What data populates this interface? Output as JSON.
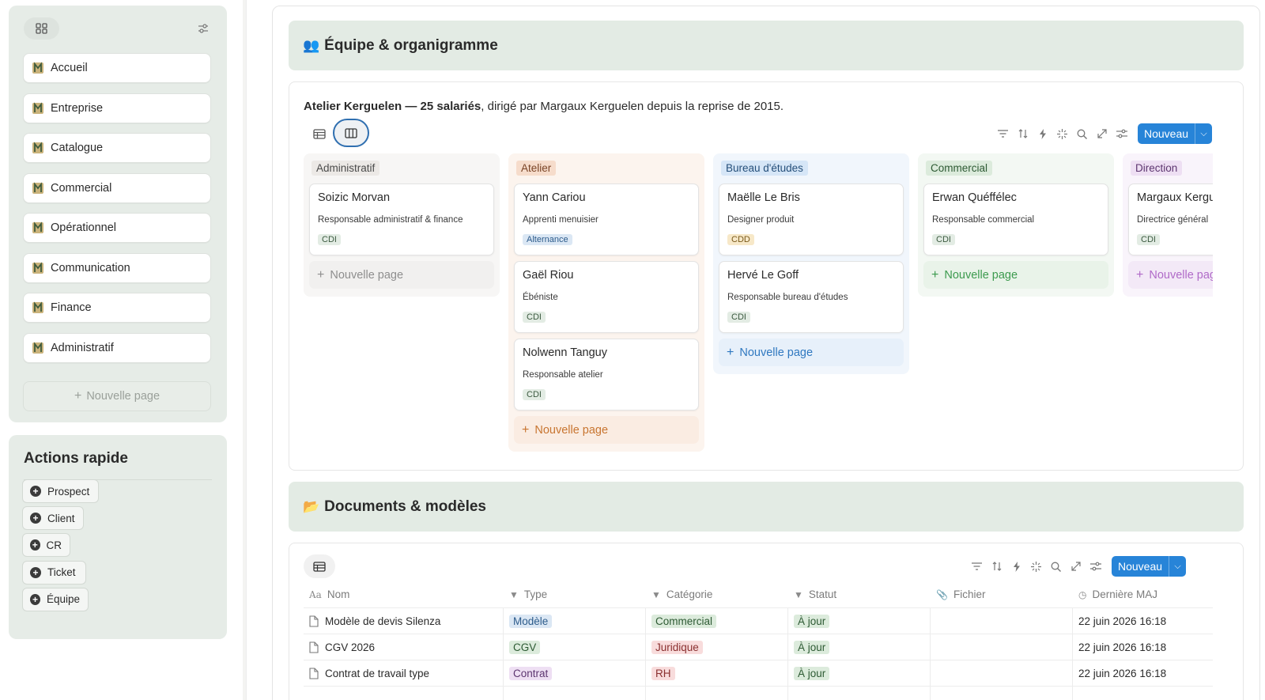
{
  "sidebar": {
    "nav_items": [
      {
        "label": "Accueil"
      },
      {
        "label": "Entreprise"
      },
      {
        "label": "Catalogue"
      },
      {
        "label": "Commercial"
      },
      {
        "label": "Opérationnel"
      },
      {
        "label": "Communication"
      },
      {
        "label": "Finance"
      },
      {
        "label": "Administratif"
      }
    ],
    "new_page_label": "Nouvelle page",
    "actions": {
      "title": "Actions rapide",
      "items": [
        {
          "label": "Prospect"
        },
        {
          "label": "Client"
        },
        {
          "label": "CR"
        },
        {
          "label": "Ticket"
        },
        {
          "label": "Équipe"
        }
      ]
    }
  },
  "team_section": {
    "emoji": "👥",
    "title": "Équipe & organigramme",
    "summary_bold": "Atelier Kerguelen — 25 salariés",
    "summary_rest": ", dirigé par Margaux Kerguelen depuis la reprise de 2015.",
    "new_button": "Nouveau",
    "columns": [
      {
        "tag": "Administratif",
        "tag_bg": "#ece9e6",
        "tag_color": "#4a4a4a",
        "col_bg": "#f7f6f5",
        "new_color": "#8e8e8e",
        "new_bg": "#f1f0ef",
        "cards": [
          {
            "name": "Soizic Morvan",
            "role": "Responsable administratif & finance",
            "badge": "CDI",
            "badge_bg": "#e3ece4",
            "badge_color": "#3c5a40"
          }
        ]
      },
      {
        "tag": "Atelier",
        "tag_bg": "#f6dccb",
        "tag_color": "#7a4426",
        "col_bg": "#fcf4ee",
        "new_color": "#c87530",
        "new_bg": "#faece2",
        "cards": [
          {
            "name": "Yann Cariou",
            "role": "Apprenti menuisier",
            "badge": "Alternance",
            "badge_bg": "#dbe7f4",
            "badge_color": "#2d5c8c"
          },
          {
            "name": "Gaël Riou",
            "role": "Ébéniste",
            "badge": "CDI",
            "badge_bg": "#e3ece4",
            "badge_color": "#3c5a40"
          },
          {
            "name": "Nolwenn Tanguy",
            "role": "Responsable atelier",
            "badge": "CDI",
            "badge_bg": "#e3ece4",
            "badge_color": "#3c5a40"
          }
        ]
      },
      {
        "tag": "Bureau d'études",
        "tag_bg": "#d6e6f7",
        "tag_color": "#254f7a",
        "col_bg": "#f1f6fc",
        "new_color": "#2f78c0",
        "new_bg": "#e7f0fa",
        "cards": [
          {
            "name": "Maëlle Le Bris",
            "role": "Designer produit",
            "badge": "CDD",
            "badge_bg": "#f7e8c8",
            "badge_color": "#7a5a1c"
          },
          {
            "name": "Hervé Le Goff",
            "role": "Responsable bureau d'études",
            "badge": "CDI",
            "badge_bg": "#e3ece4",
            "badge_color": "#3c5a40"
          }
        ]
      },
      {
        "tag": "Commercial",
        "tag_bg": "#dcebdc",
        "tag_color": "#2d5a33",
        "col_bg": "#f3f8f3",
        "new_color": "#3c9a4e",
        "new_bg": "#e9f3e9",
        "cards": [
          {
            "name": "Erwan Quéffélec",
            "role": "Responsable commercial",
            "badge": "CDI",
            "badge_bg": "#e3ece4",
            "badge_color": "#3c5a40"
          }
        ]
      },
      {
        "tag": "Direction",
        "tag_bg": "#eedff3",
        "tag_color": "#5d3570",
        "col_bg": "#f9f4fb",
        "new_color": "#b06ac8",
        "new_bg": "#f3e9f7",
        "cards": [
          {
            "name": "Margaux Kergu",
            "role": "Directrice général",
            "badge": "CDI",
            "badge_bg": "#e3ece4",
            "badge_color": "#3c5a40"
          }
        ]
      }
    ],
    "new_page_label": "Nouvelle page"
  },
  "docs_section": {
    "emoji": "📂",
    "title": "Documents & modèles",
    "new_button": "Nouveau",
    "headers": [
      "Nom",
      "Type",
      "Catégorie",
      "Statut",
      "Fichier",
      "Dernière MAJ"
    ],
    "rows": [
      {
        "nom": "Modèle de devis Silenza",
        "type": "Modèle",
        "type_bg": "#dbe7f4",
        "type_color": "#2d5c8c",
        "categorie": "Commercial",
        "cat_bg": "#dcebdc",
        "cat_color": "#2d5a33",
        "statut": "À jour",
        "fichier": "",
        "maj": "22 juin 2026 16:18"
      },
      {
        "nom": "CGV 2026",
        "type": "CGV",
        "type_bg": "#dcebdc",
        "type_color": "#2d5a33",
        "categorie": "Juridique",
        "cat_bg": "#f8dcdc",
        "cat_color": "#8a2f2f",
        "statut": "À jour",
        "fichier": "",
        "maj": "22 juin 2026 16:18"
      },
      {
        "nom": "Contrat de travail type",
        "type": "Contrat",
        "type_bg": "#eedff3",
        "type_color": "#5d3570",
        "categorie": "RH",
        "cat_bg": "#f8dcdc",
        "cat_color": "#8a2f2f",
        "statut": "À jour",
        "fichier": "",
        "maj": "22 juin 2026 16:18"
      }
    ],
    "status_bg": "#dcebdc",
    "status_color": "#2d5a33"
  }
}
